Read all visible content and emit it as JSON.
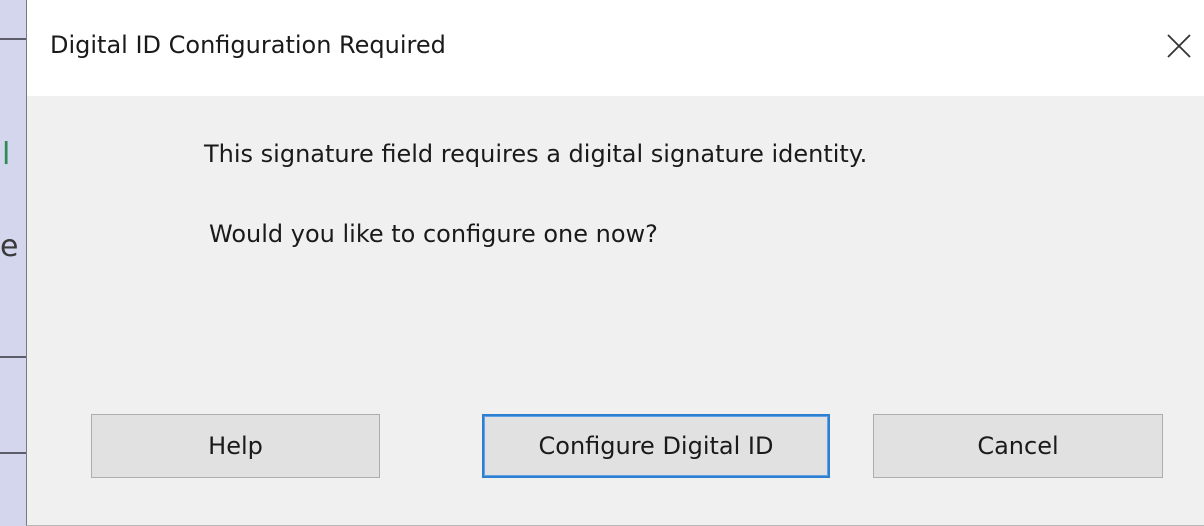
{
  "background_app": {
    "glyphs": [
      "l",
      "e"
    ]
  },
  "dialog": {
    "title": "Digital ID Configuration Required",
    "close_icon": "close-icon",
    "message_line1": "This signature field requires a digital signature identity.",
    "message_line2": "Would you like to configure one now?",
    "buttons": {
      "help": "Help",
      "configure": "Configure Digital ID",
      "cancel": "Cancel"
    },
    "colors": {
      "dialog_bg": "#f0f0f0",
      "titlebar_bg": "#ffffff",
      "button_bg": "#e1e1e1",
      "default_button_border": "#2f7fd1"
    }
  }
}
